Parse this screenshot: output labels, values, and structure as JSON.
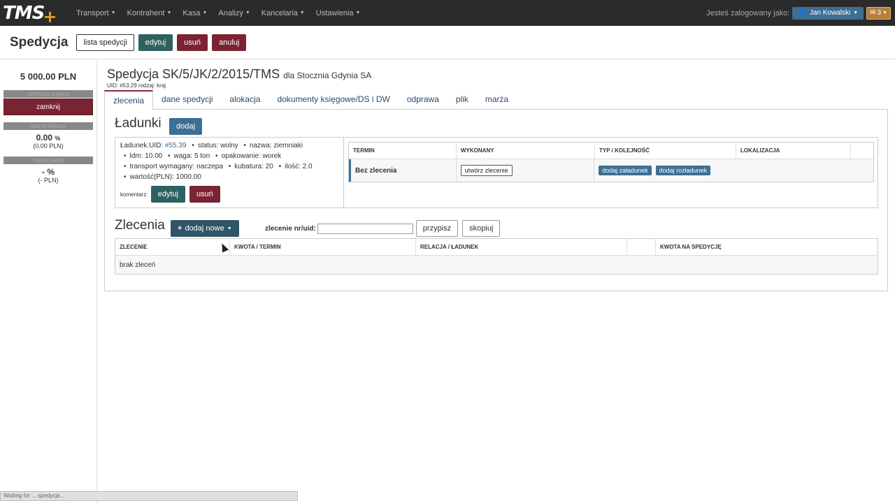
{
  "navbar": {
    "logo": "TMS",
    "logo_plus": "+",
    "menu": [
      "Transport",
      "Kontrahent",
      "Kasa",
      "Analizy",
      "Kancelaria",
      "Ustawienia"
    ],
    "logged_label": "Jesteś zalogowany jako:",
    "user": "Jan Kowalski",
    "mail_count": "3"
  },
  "pagebar": {
    "title": "Spedycja",
    "buttons": {
      "list": "lista spedycji",
      "edit": "edytuj",
      "delete": "usuń",
      "cancel": "anuluj"
    }
  },
  "sidebar": {
    "amount": "5 000.00 PLN",
    "head1": "spedycja otwarta",
    "close": "zamknij",
    "head2": "marża własna",
    "margin_value": "0.00",
    "margin_unit": "%",
    "margin_pln": "(0.00 PLN)",
    "head3": "marża pełna",
    "full_value": "- %",
    "full_pln": "(- PLN)"
  },
  "main": {
    "title": "Spedycja SK/5/JK/2/2015/TMS",
    "title_for": "dla Stocznia Gdynia SA",
    "uid_line": "UID: #53.29 rodzaj: kraj",
    "tabs": [
      "zlecenia",
      "dane spedycji",
      "alokacja",
      "dokumenty księgowe/DS i DW",
      "odprawa",
      "plik",
      "marża"
    ]
  },
  "ladunki": {
    "title": "Ładunki",
    "add": "dodaj",
    "uid_label": "Ładunek.UID:",
    "uid_value": "#55.39",
    "status": "status: wolny",
    "nazwa": "nazwa: ziemniaki",
    "ldm": "ldm: 10.00",
    "waga": "waga: 5 ton",
    "opakowanie": "opakowanie: worek",
    "transport": "transport wymagany: naczepa",
    "kubatura": "kubatura: 20",
    "ilosc": "ilość: 2.0",
    "wartosc": "wartość(PLN): 1000.00",
    "comment_label": "komentarz:",
    "edit": "edytuj",
    "delete": "usuń"
  },
  "term_table": {
    "headers": [
      "TERMIN",
      "WYKONANY",
      "TYP / KOLEJNOŚĆ",
      "LOKALIZACJA",
      ""
    ],
    "row_term": "Bez zlecenia",
    "create_order": "utwórz zlecenie",
    "add_loading": "dodaj załadunek",
    "add_unloading": "dodaj rozładunek"
  },
  "zlecenia": {
    "title": "Zlecenia",
    "add_new": "dodaj nowe",
    "order_label": "zlecenie nr/uid:",
    "assign": "przypisz",
    "copy": "skopiuj",
    "headers": [
      "ZLECENIE",
      "KWOTA / TERMIN",
      "RELACJA / ŁADUNEK",
      "",
      "KWOTA NA SPEDYCJĘ"
    ],
    "empty": "brak zleceń"
  },
  "statusbar": "Waiting for ... spedycja..."
}
